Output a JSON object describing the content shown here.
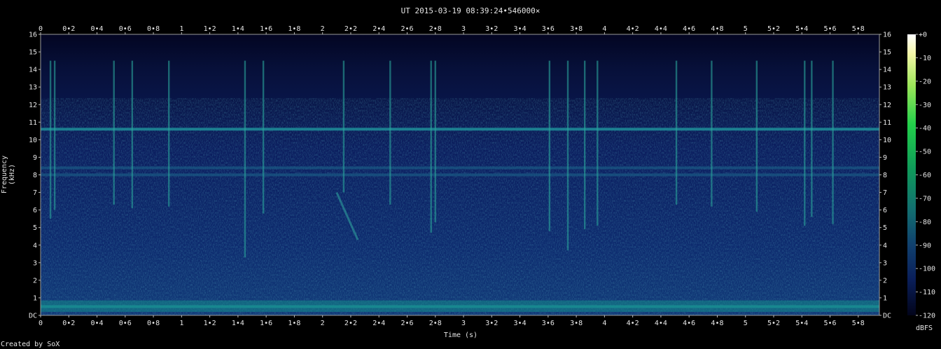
{
  "chart_data": {
    "type": "heatmap",
    "title": "UT 2015-03-19 08:39:24•546000×",
    "xlabel": "Time (s)",
    "ylabel": "Frequency (kHz)",
    "xlim": [
      0,
      5.95
    ],
    "ylim": [
      0,
      16
    ],
    "x_ticks": [
      "0",
      "0•2",
      "0•4",
      "0•6",
      "0•8",
      "1",
      "1•2",
      "1•4",
      "1•6",
      "1•8",
      "2",
      "2•2",
      "2•4",
      "2•6",
      "2•8",
      "3",
      "3•2",
      "3•4",
      "3•6",
      "3•8",
      "4",
      "4•2",
      "4•4",
      "4•6",
      "4•8",
      "5",
      "5•2",
      "5•4",
      "5•6",
      "5•8"
    ],
    "y_ticks": [
      "DC",
      "1",
      "2",
      "3",
      "4",
      "5",
      "6",
      "7",
      "8",
      "9",
      "10",
      "11",
      "12",
      "13",
      "14",
      "15",
      "16"
    ],
    "colorbar": {
      "label": "dBFS",
      "ticks": [
        "+0",
        "-10",
        "-20",
        "-30",
        "-40",
        "-50",
        "-60",
        "-70",
        "-80",
        "-90",
        "-100",
        "-110",
        "-120"
      ]
    },
    "features": {
      "tone_khz": [
        10.6,
        8.4,
        8.0,
        0.5
      ],
      "impulses_s": [
        0.07,
        0.1,
        0.52,
        0.65,
        0.91,
        1.45,
        1.58,
        2.15,
        2.48,
        2.77,
        2.8,
        3.61,
        3.74,
        3.86,
        3.95,
        4.51,
        4.76,
        5.08,
        5.42,
        5.47,
        5.62
      ],
      "chirp": {
        "t": [
          2.1,
          2.25
        ],
        "f_khz": [
          7.0,
          4.3
        ]
      }
    }
  },
  "credit": "Created by SoX"
}
